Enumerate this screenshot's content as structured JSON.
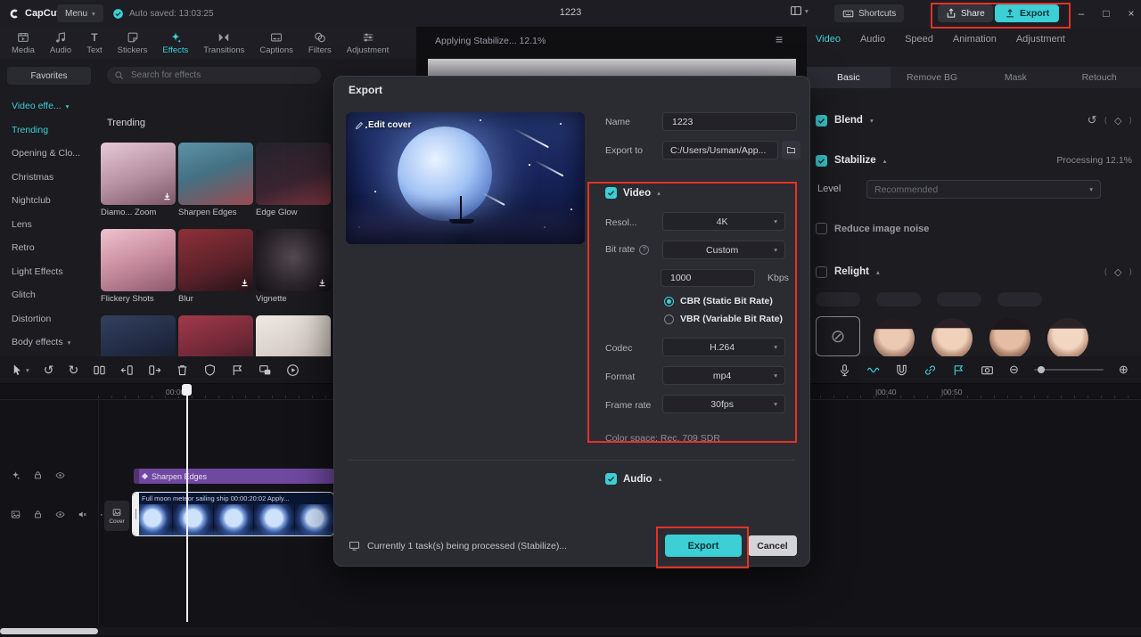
{
  "colors": {
    "accent": "#3ccfd5",
    "highlight_red": "#e53126",
    "effect_clip_purple": "#6f48a0",
    "clip_navy": "#0e1c3e"
  },
  "topbar": {
    "logo": "CapCut",
    "menu": "Menu",
    "autosave": "Auto saved: 13:03:25",
    "title": "1223",
    "shortcuts": "Shortcuts",
    "share": "Share",
    "export": "Export"
  },
  "ribbon": {
    "tabs": [
      {
        "label": "Media"
      },
      {
        "label": "Audio"
      },
      {
        "label": "Text"
      },
      {
        "label": "Stickers"
      },
      {
        "label": "Effects"
      },
      {
        "label": "Transitions"
      },
      {
        "label": "Captions"
      },
      {
        "label": "Filters"
      },
      {
        "label": "Adjustment"
      }
    ]
  },
  "effects_panel": {
    "favorites": "Favorites",
    "category_group": "Video effe...",
    "categories": [
      {
        "label": "Trending"
      },
      {
        "label": "Opening & Clo..."
      },
      {
        "label": "Christmas"
      },
      {
        "label": "Nightclub"
      },
      {
        "label": "Lens"
      },
      {
        "label": "Retro"
      },
      {
        "label": "Light Effects"
      },
      {
        "label": "Glitch"
      },
      {
        "label": "Distortion"
      }
    ],
    "body_effects": "Body effects",
    "search_placeholder": "Search for effects",
    "section_title": "Trending",
    "effects": [
      {
        "name": "Diamo... Zoom"
      },
      {
        "name": "Sharpen Edges"
      },
      {
        "name": "Edge Glow"
      },
      {
        "name": "Flickery Shots"
      },
      {
        "name": "Blur"
      },
      {
        "name": "Vignette"
      },
      {
        "name": ""
      },
      {
        "name": ""
      },
      {
        "name": ""
      }
    ]
  },
  "preview": {
    "status": "Applying Stabilize... 12.1%"
  },
  "export_dialog": {
    "title": "Export",
    "edit_cover": "Edit cover",
    "name_label": "Name",
    "name_value": "1223",
    "export_to_label": "Export to",
    "export_path": "C:/Users/Usman/App...",
    "video_label": "Video",
    "resolution_label": "Resol...",
    "resolution_value": "4K",
    "bitrate_label": "Bit rate",
    "bitrate_value": "Custom",
    "bitrate_amount": "1000",
    "bitrate_unit": "Kbps",
    "cbr_label": "CBR (Static Bit Rate)",
    "vbr_label": "VBR (Variable Bit Rate)",
    "codec_label": "Codec",
    "codec_value": "H.264",
    "format_label": "Format",
    "format_value": "mp4",
    "framerate_label": "Frame rate",
    "framerate_value": "30fps",
    "color_space": "Color space: Rec. 709 SDR",
    "audio_label": "Audio",
    "task_status": "Currently 1 task(s) being processed (Stabilize)...",
    "export_button": "Export",
    "cancel_button": "Cancel"
  },
  "inspector": {
    "tabs": [
      {
        "label": "Video"
      },
      {
        "label": "Audio"
      },
      {
        "label": "Speed"
      },
      {
        "label": "Animation"
      },
      {
        "label": "Adjustment"
      }
    ],
    "subtabs": [
      {
        "label": "Basic"
      },
      {
        "label": "Remove BG"
      },
      {
        "label": "Mask"
      },
      {
        "label": "Retouch"
      }
    ],
    "blend": "Blend",
    "stabilize": "Stabilize",
    "stabilize_status": "Processing 12.1%",
    "level_label": "Level",
    "level_value": "Recommended",
    "noise": "Reduce image noise",
    "relight": "Relight"
  },
  "timeline": {
    "ruler": [
      {
        "label": "00:00"
      },
      {
        "label": "|00:40"
      },
      {
        "label": "|00:50"
      }
    ],
    "effect_clip": "Sharpen Edges",
    "video_clip": "Full moon meteor sailing ship  00:00:20:02  Apply...",
    "cover": "Cover"
  }
}
